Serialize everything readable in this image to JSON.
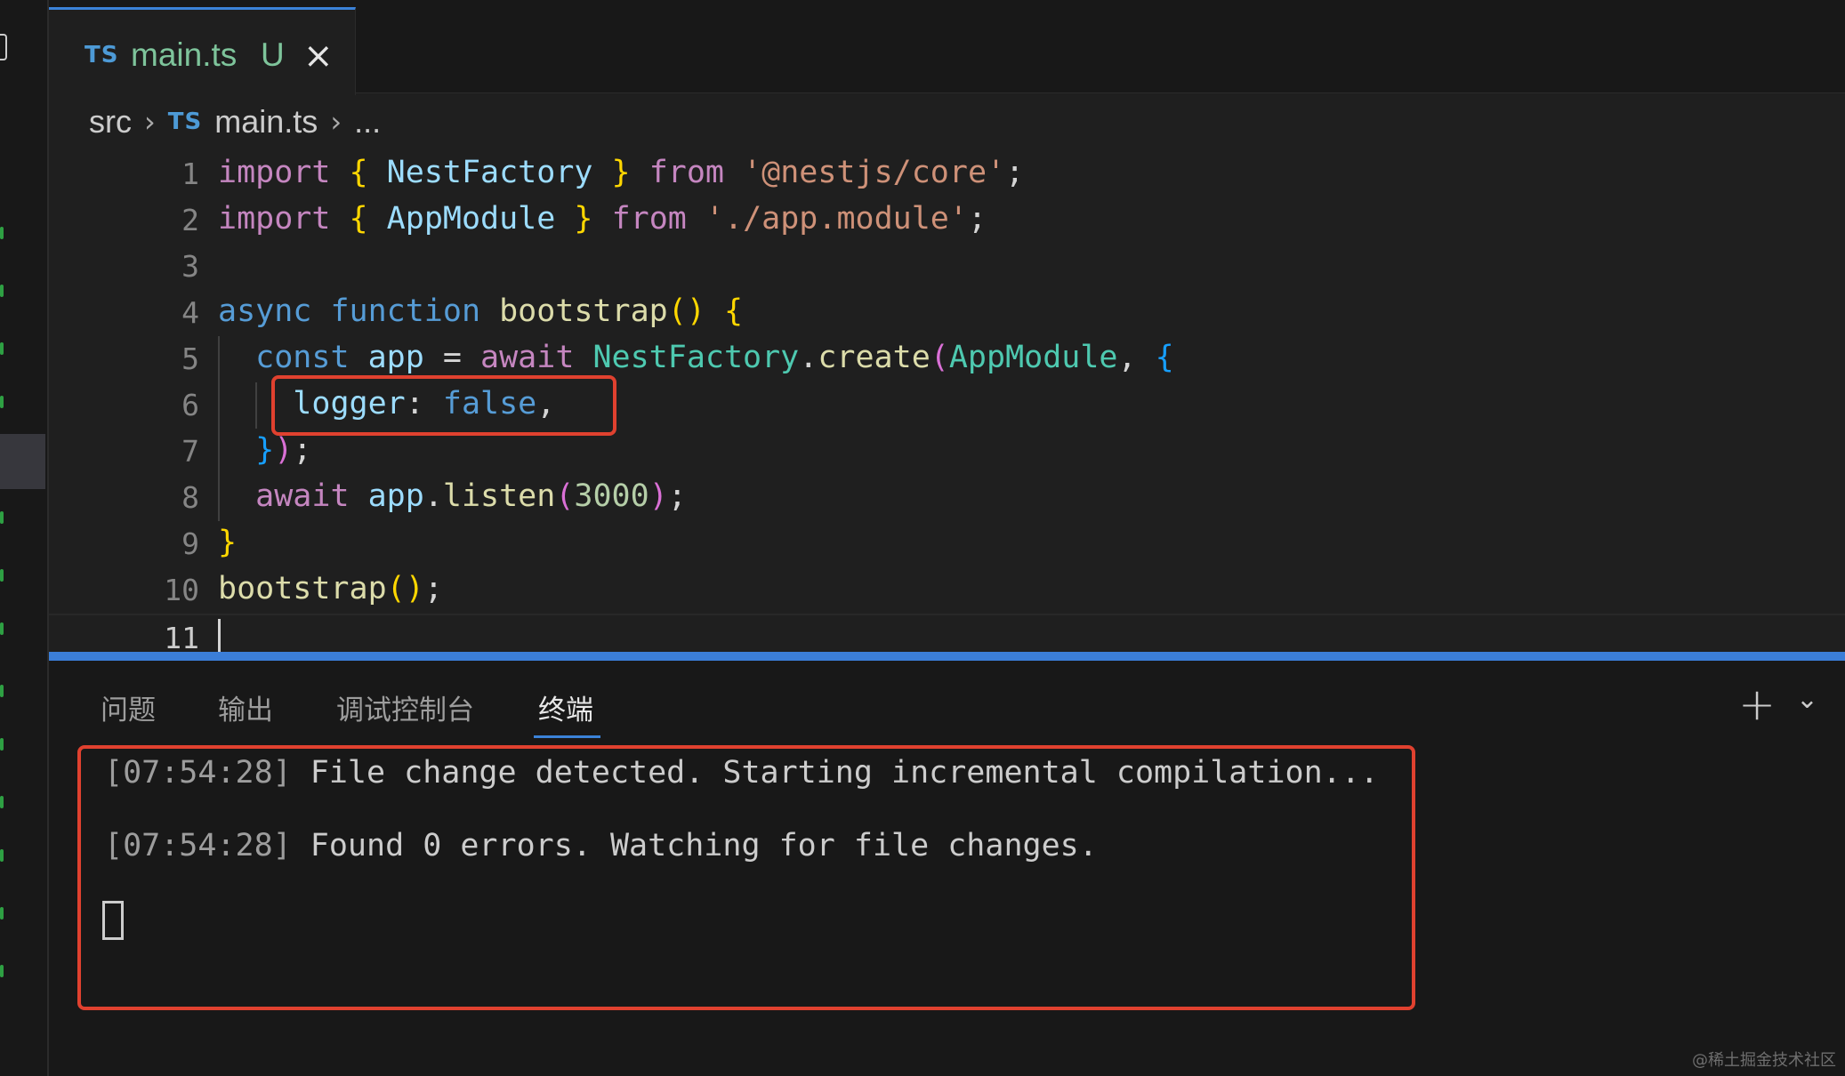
{
  "tab": {
    "lang": "TS",
    "title": "main.ts",
    "status": "U",
    "close": "×"
  },
  "breadcrumb": {
    "folder": "src",
    "lang": "TS",
    "file": "main.ts",
    "sep": "›",
    "more": "..."
  },
  "code": {
    "line_numbers": [
      "1",
      "2",
      "3",
      "4",
      "5",
      "6",
      "7",
      "8",
      "9",
      "10",
      "11"
    ],
    "active_line": 11
  },
  "panel": {
    "tabs": [
      "问题",
      "输出",
      "调试控制台",
      "终端"
    ],
    "active_tab": "终端",
    "plus": "+",
    "chevron": "⌄"
  },
  "terminal": {
    "lines": [
      {
        "time": "[07:54:28]",
        "text": " File change detected. Starting incremental compilation..."
      },
      {
        "time": "[07:54:28]",
        "text": " Found 0 errors. Watching for file changes."
      }
    ]
  },
  "watermark": "@稀土掘金技术社区"
}
